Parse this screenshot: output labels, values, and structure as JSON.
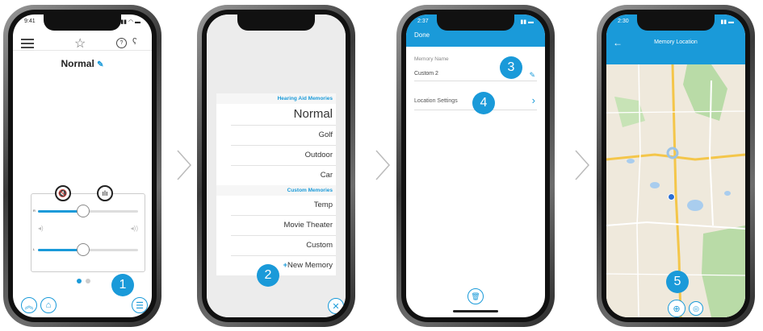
{
  "phone1": {
    "status_time": "9:41",
    "title": "Normal",
    "badge": "1",
    "slider_r_label": "R",
    "slider_l_label": "L",
    "slider_r_value": 0.45,
    "slider_l_value": 0.45
  },
  "phone2": {
    "header_hearing": "Hearing Aid Memories",
    "hearing_items": [
      "Normal",
      "Golf",
      "Outdoor",
      "Car"
    ],
    "header_custom": "Custom Memories",
    "custom_items": [
      "Temp",
      "Movie Theater",
      "Custom"
    ],
    "new_memory_plus": "+",
    "new_memory": "New Memory",
    "badge": "2"
  },
  "phone3": {
    "status_time": "2:37",
    "done_label": "Done",
    "memory_name_label": "Memory Name",
    "memory_name_value": "Custom 2",
    "location_settings_label": "Location Settings",
    "badge3": "3",
    "badge4": "4"
  },
  "phone4": {
    "status_time": "2:30",
    "title": "Memory Location",
    "badge": "5"
  },
  "colors": {
    "accent": "#1a9ad9"
  }
}
